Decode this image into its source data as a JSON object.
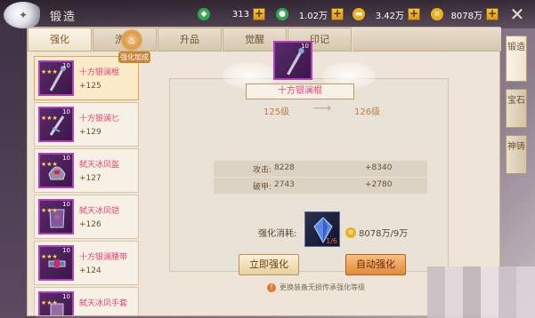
{
  "title": "锻造",
  "resources": [
    {
      "icon": "jade-icon",
      "value": "313",
      "color": "#2fa84f"
    },
    {
      "icon": "gem-icon",
      "value": "1.02万",
      "color": "#2fa84f"
    },
    {
      "icon": "ingot-icon",
      "value": "3.42万",
      "color": "#e8b21c"
    },
    {
      "icon": "coin-icon",
      "value": "8078万",
      "color": "#e8b21c"
    }
  ],
  "tabs": [
    "强化",
    "洗炼",
    "升品",
    "觉醒",
    "印记"
  ],
  "active_tab": 0,
  "side_tabs": [
    "锻造",
    "宝石",
    "神铸"
  ],
  "bonus_label": "强化加成",
  "items": [
    {
      "name": "十方银澜棍",
      "value": "+125",
      "level": "10",
      "stars": "★★★"
    },
    {
      "name": "十方银澜匕",
      "value": "+129",
      "level": "10",
      "stars": "★★★"
    },
    {
      "name": "弑天冰凤盔",
      "value": "+127",
      "level": "10",
      "stars": "★★★"
    },
    {
      "name": "弑天冰凤铠",
      "value": "+126",
      "level": "10",
      "stars": "★★★"
    },
    {
      "name": "十方银澜腰带",
      "value": "+124",
      "level": "10",
      "stars": "★★★"
    },
    {
      "name": "弑天冰凤手套",
      "value": "",
      "level": "10",
      "stars": "★★★"
    }
  ],
  "detail": {
    "name": "十方银澜棍",
    "level_from": "125级",
    "level_to": "126级",
    "item_level": "10",
    "stats": [
      {
        "label": "攻击:",
        "current": "8228",
        "next": "+8340"
      },
      {
        "label": "破甲:",
        "current": "2743",
        "next": "+2780"
      }
    ],
    "cost_label": "强化消耗:",
    "gem_count": "1/6",
    "coin_cost": "8078万/9万",
    "btn_now": "立即强化",
    "btn_auto": "自动强化",
    "notice": "更换装备无损传承强化等级"
  }
}
